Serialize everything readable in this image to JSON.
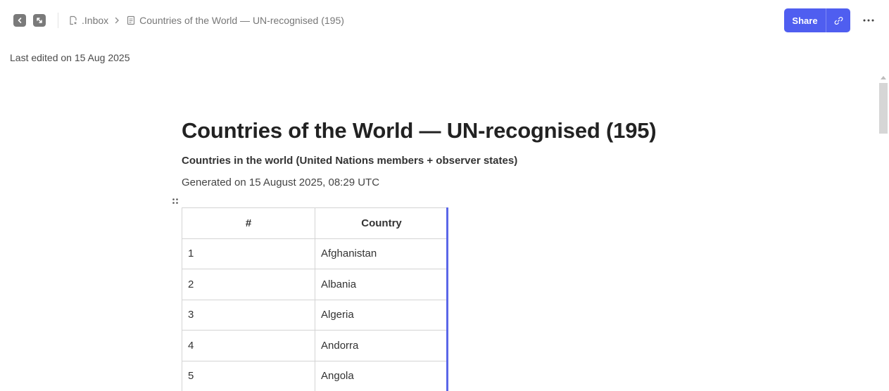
{
  "breadcrumb": {
    "folder": ".Inbox",
    "page": "Countries of the World — UN-recognised (195)"
  },
  "header": {
    "share_label": "Share"
  },
  "meta": {
    "last_edited": "Last edited on 15 Aug 2025"
  },
  "document": {
    "title": "Countries of the World — UN-recognised (195)",
    "subtitle": "Countries in the world (United Nations members + observer states)",
    "generated": "Generated on 15 August 2025, 08:29 UTC"
  },
  "table": {
    "columns": [
      "#",
      "Country"
    ],
    "rows": [
      [
        "1",
        "Afghanistan"
      ],
      [
        "2",
        "Albania"
      ],
      [
        "3",
        "Algeria"
      ],
      [
        "4",
        "Andorra"
      ],
      [
        "5",
        "Angola"
      ]
    ]
  },
  "colors": {
    "accent": "#4f5ef0",
    "column_highlight": "#5b67e8"
  },
  "icons": {
    "back": "chevron-left-icon",
    "expand": "expand-icon",
    "folder": "document-star-icon",
    "page": "document-icon",
    "link": "link-icon",
    "more": "more-horizontal-icon",
    "drag": "drag-handle-icon"
  }
}
